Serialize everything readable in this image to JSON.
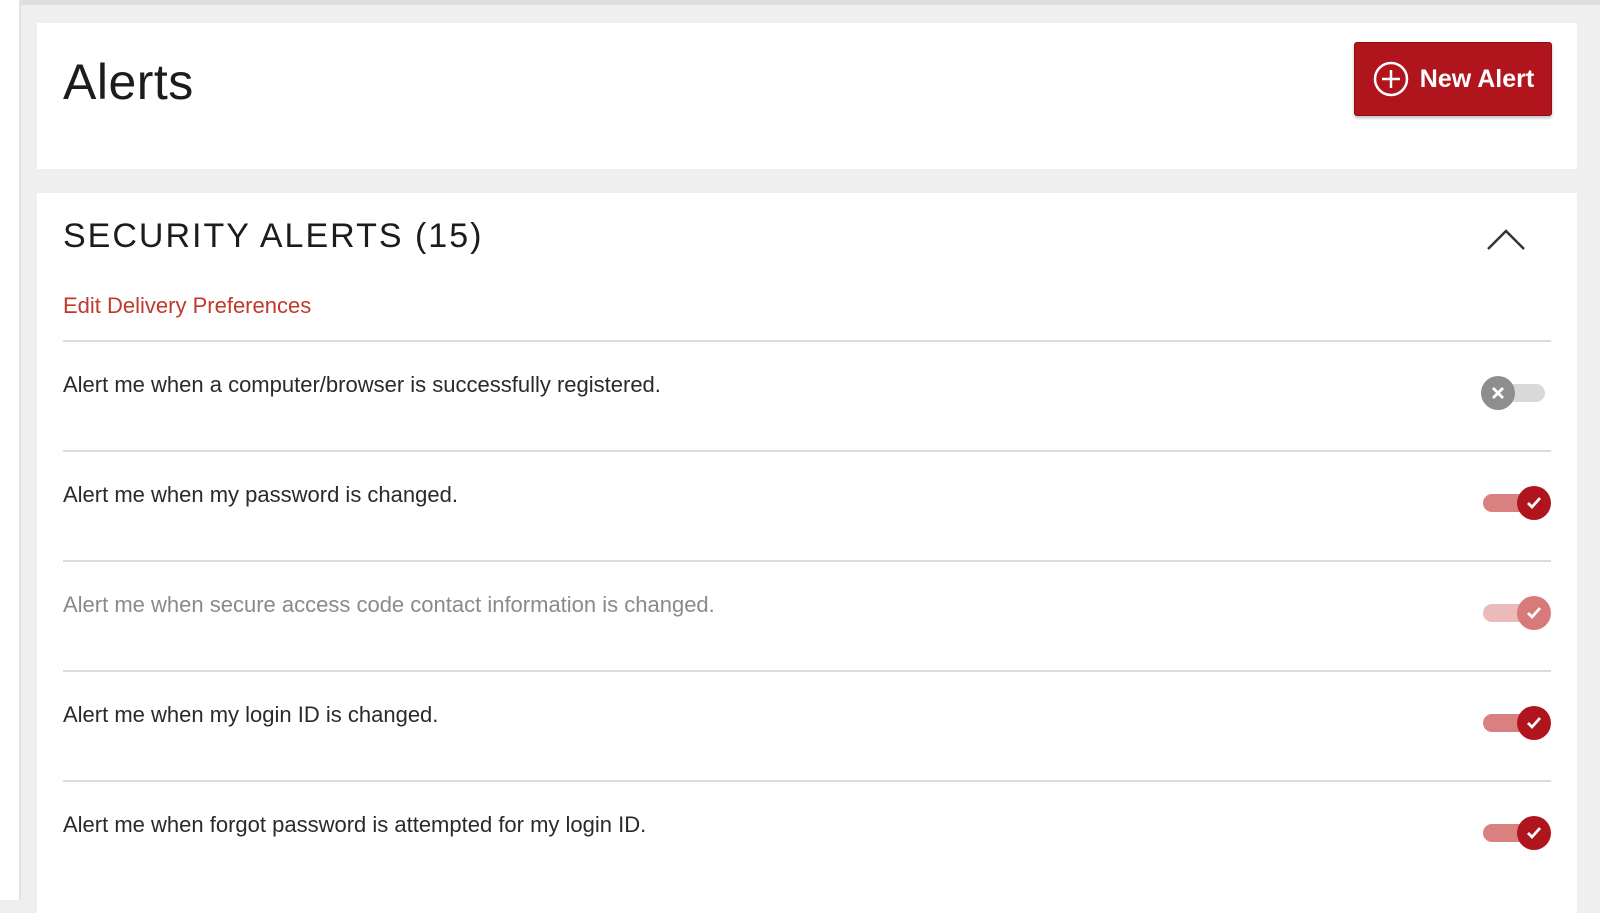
{
  "header": {
    "title": "Alerts",
    "new_alert_label": "New Alert"
  },
  "security_section": {
    "title": "SECURITY ALERTS (15)",
    "edit_link": "Edit Delivery Preferences",
    "collapse_icon": "chevron-up-icon",
    "alerts": [
      {
        "label": "Alert me when a computer/browser is successfully registered.",
        "enabled": false,
        "editable": true
      },
      {
        "label": "Alert me when my password is changed.",
        "enabled": true,
        "editable": true
      },
      {
        "label": "Alert me when secure access code contact information is changed.",
        "enabled": true,
        "editable": false
      },
      {
        "label": "Alert me when my login ID is changed.",
        "enabled": true,
        "editable": true
      },
      {
        "label": "Alert me when forgot password is attempted for my login ID.",
        "enabled": true,
        "editable": true
      }
    ]
  },
  "colors": {
    "brand_red": "#b0141c",
    "link_red": "#c0392b"
  }
}
